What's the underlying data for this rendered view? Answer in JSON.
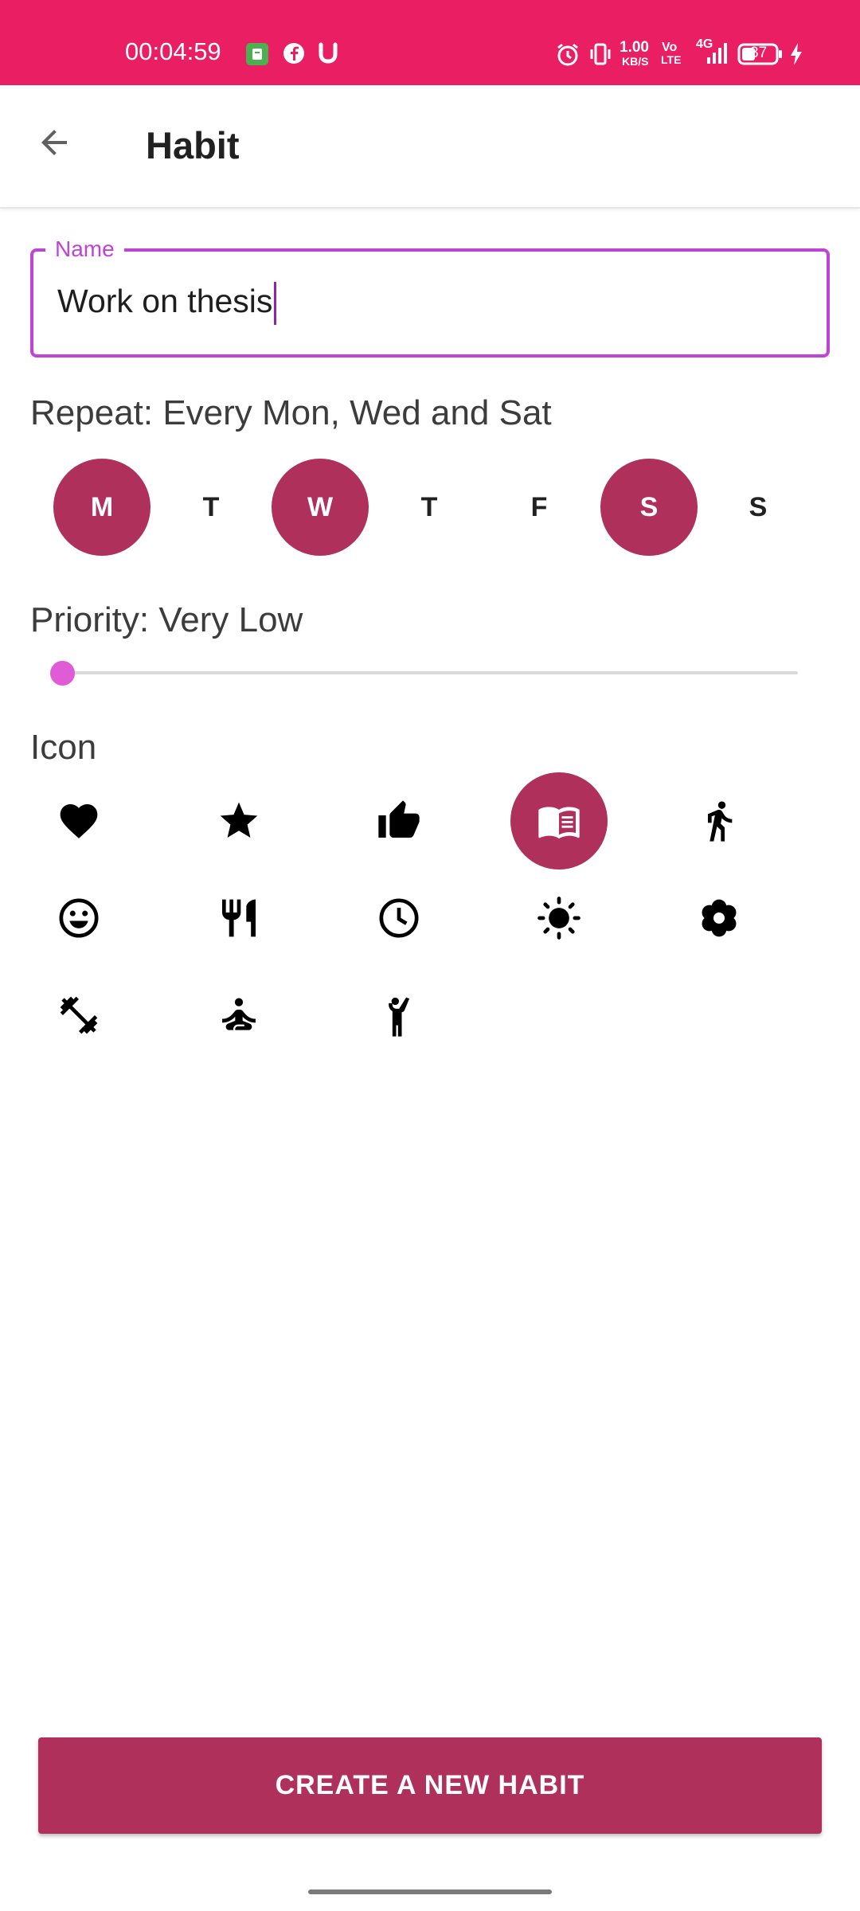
{
  "status_bar": {
    "time": "00:04:59",
    "net_speed_value": "1.00",
    "net_speed_unit": "KB/S",
    "volte_top": "Vo",
    "volte_bottom": "LTE",
    "network": "4G",
    "battery": "37",
    "icons": [
      "app-notification-icon",
      "facebook-icon",
      "u-app-icon",
      "alarm-icon",
      "vibrate-icon",
      "signal-icon",
      "battery-icon",
      "charging-icon"
    ]
  },
  "app_bar": {
    "back_icon": "arrow-back-icon",
    "title": "Habit"
  },
  "name_field": {
    "label": "Name",
    "value": "Work on thesis"
  },
  "repeat": {
    "label": "Repeat: Every Mon, Wed and Sat",
    "days": [
      {
        "letter": "M",
        "selected": true
      },
      {
        "letter": "T",
        "selected": false
      },
      {
        "letter": "W",
        "selected": true
      },
      {
        "letter": "T",
        "selected": false
      },
      {
        "letter": "F",
        "selected": false
      },
      {
        "letter": "S",
        "selected": true
      },
      {
        "letter": "S",
        "selected": false
      }
    ]
  },
  "priority": {
    "label": "Priority: Very Low",
    "slider_value": 0
  },
  "icon_section": {
    "label": "Icon",
    "icons": [
      {
        "name": "heart-icon",
        "selected": false
      },
      {
        "name": "star-icon",
        "selected": false
      },
      {
        "name": "thumb-up-icon",
        "selected": false
      },
      {
        "name": "book-icon",
        "selected": true
      },
      {
        "name": "walk-icon",
        "selected": false
      },
      {
        "name": "smiley-icon",
        "selected": false
      },
      {
        "name": "restaurant-icon",
        "selected": false
      },
      {
        "name": "clock-icon",
        "selected": false
      },
      {
        "name": "sun-icon",
        "selected": false
      },
      {
        "name": "flower-icon",
        "selected": false
      },
      {
        "name": "fitness-icon",
        "selected": false
      },
      {
        "name": "meditation-icon",
        "selected": false
      },
      {
        "name": "person-raising-hand-icon",
        "selected": false
      }
    ]
  },
  "create_button": {
    "label": "CREATE A NEW HABIT"
  },
  "colors": {
    "status_bar": "#e91e63",
    "accent": "#b0305c",
    "field_outline": "#c043d6",
    "slider_thumb": "#e05bd6"
  }
}
